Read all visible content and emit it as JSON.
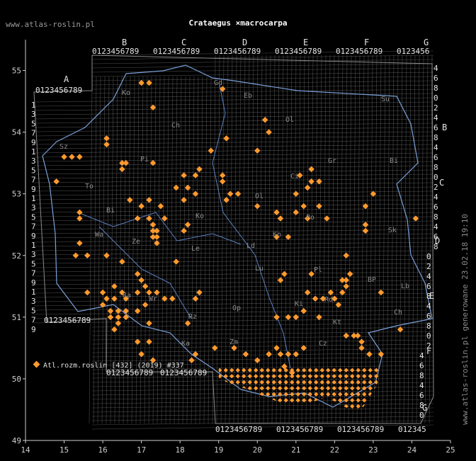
{
  "header": {
    "site": "www.atlas-roslin.pl",
    "title": "Crataegus ×macrocarpa"
  },
  "footer": {
    "text": "www.atlas-roslin.pl generowane 23.02.18 19:10"
  },
  "legend": {
    "label": "Atl.rozm.roslin [432] (2019) #337",
    "marker_color": "#ff9a2e"
  },
  "grid_labels": {
    "top_major": [
      "B",
      "C",
      "D",
      "E",
      "F",
      "G"
    ],
    "a_label": "A",
    "digits_row": "0123456789",
    "right_letters": [
      "B",
      "C",
      "D",
      "E",
      "F",
      "G"
    ],
    "right_digits": [
      "4",
      "6",
      "8",
      "0",
      "2",
      "4",
      "6",
      "8"
    ]
  },
  "region_labels": [
    "Sz",
    "Ko",
    "Gd",
    "Eb",
    "Ol",
    "Su",
    "Ch",
    "Pi",
    "Bi",
    "Ci",
    "Gr",
    "To",
    "Ol",
    "Po",
    "Ko",
    "Bi",
    "Ld",
    "Wa",
    "Ze",
    "Le",
    "Kn",
    "Sk",
    "BP",
    "Lu",
    "Pl",
    "Ra",
    "Wr",
    "Op",
    "Ki",
    "Rd",
    "Lb",
    "Ch",
    "Zm",
    "Kt",
    "Rz",
    "Ka",
    "Cz"
  ],
  "chart_data": {
    "type": "scatter",
    "xlim": [
      14,
      25
    ],
    "ylim": [
      49,
      55.5
    ],
    "x_ticks": [
      14,
      15,
      16,
      17,
      18,
      19,
      20,
      21,
      22,
      23,
      24,
      25
    ],
    "y_ticks": [
      49,
      50,
      51,
      52,
      53,
      54,
      55
    ],
    "marker_color": "#ff9a2e",
    "grid_color": "#6a6a6a",
    "points": [
      [
        17.0,
        54.8
      ],
      [
        17.2,
        54.8
      ],
      [
        19.1,
        54.7
      ],
      [
        17.3,
        54.4
      ],
      [
        20.2,
        54.2
      ],
      [
        20.3,
        54.0
      ],
      [
        19.2,
        53.9
      ],
      [
        16.1,
        53.9
      ],
      [
        16.1,
        53.8
      ],
      [
        15.0,
        53.6
      ],
      [
        15.2,
        53.6
      ],
      [
        15.4,
        53.6
      ],
      [
        18.8,
        53.7
      ],
      [
        20.0,
        53.7
      ],
      [
        16.5,
        53.5
      ],
      [
        16.6,
        53.5
      ],
      [
        17.3,
        53.5
      ],
      [
        16.5,
        53.4
      ],
      [
        18.5,
        53.4
      ],
      [
        14.8,
        53.2
      ],
      [
        21.4,
        53.4
      ],
      [
        21.1,
        53.3
      ],
      [
        21.4,
        53.2
      ],
      [
        21.6,
        53.2
      ],
      [
        18.1,
        53.3
      ],
      [
        18.4,
        53.3
      ],
      [
        19.1,
        53.3
      ],
      [
        19.1,
        53.2
      ],
      [
        21.3,
        53.1
      ],
      [
        17.9,
        53.1
      ],
      [
        18.2,
        53.1
      ],
      [
        18.4,
        53.0
      ],
      [
        19.3,
        53.0
      ],
      [
        19.5,
        53.0
      ],
      [
        21.0,
        53.0
      ],
      [
        23.0,
        53.0
      ],
      [
        16.7,
        52.9
      ],
      [
        17.0,
        52.8
      ],
      [
        17.2,
        52.9
      ],
      [
        17.5,
        52.8
      ],
      [
        18.1,
        52.9
      ],
      [
        19.2,
        52.9
      ],
      [
        20.0,
        52.8
      ],
      [
        21.2,
        52.8
      ],
      [
        21.6,
        52.8
      ],
      [
        15.4,
        52.7
      ],
      [
        15.4,
        52.6
      ],
      [
        20.5,
        52.7
      ],
      [
        20.6,
        52.6
      ],
      [
        21.0,
        52.7
      ],
      [
        21.3,
        52.6
      ],
      [
        21.8,
        52.6
      ],
      [
        22.8,
        52.8
      ],
      [
        16.9,
        52.6
      ],
      [
        17.2,
        52.6
      ],
      [
        17.6,
        52.6
      ],
      [
        17.3,
        52.5
      ],
      [
        17.4,
        52.4
      ],
      [
        18.2,
        52.5
      ],
      [
        18.1,
        52.4
      ],
      [
        17.4,
        52.3
      ],
      [
        17.4,
        52.2
      ],
      [
        17.3,
        52.4
      ],
      [
        17.3,
        52.3
      ],
      [
        22.8,
        52.5
      ],
      [
        22.8,
        52.4
      ],
      [
        24.1,
        52.6
      ],
      [
        20.5,
        52.3
      ],
      [
        20.8,
        52.3
      ],
      [
        15.4,
        52.2
      ],
      [
        15.3,
        52.0
      ],
      [
        16.1,
        52.0
      ],
      [
        15.6,
        52.0
      ],
      [
        16.5,
        51.9
      ],
      [
        17.9,
        51.9
      ],
      [
        22.3,
        52.0
      ],
      [
        16.9,
        51.7
      ],
      [
        17.0,
        51.6
      ],
      [
        17.1,
        51.5
      ],
      [
        20.7,
        51.7
      ],
      [
        21.4,
        51.7
      ],
      [
        20.6,
        51.6
      ],
      [
        22.3,
        51.6
      ],
      [
        22.4,
        51.7
      ],
      [
        22.2,
        51.6
      ],
      [
        22.3,
        51.5
      ],
      [
        22.2,
        51.4
      ],
      [
        23.2,
        51.4
      ],
      [
        15.6,
        51.4
      ],
      [
        16.0,
        51.4
      ],
      [
        16.3,
        51.5
      ],
      [
        16.5,
        51.4
      ],
      [
        16.1,
        51.3
      ],
      [
        16.3,
        51.3
      ],
      [
        16.6,
        51.3
      ],
      [
        16.9,
        51.4
      ],
      [
        17.2,
        51.4
      ],
      [
        17.4,
        51.4
      ],
      [
        17.6,
        51.3
      ],
      [
        17.8,
        51.3
      ],
      [
        18.4,
        51.3
      ],
      [
        18.5,
        51.4
      ],
      [
        21.3,
        51.4
      ],
      [
        21.5,
        51.3
      ],
      [
        21.7,
        51.3
      ],
      [
        21.9,
        51.4
      ],
      [
        22.0,
        51.3
      ],
      [
        22.1,
        51.2
      ],
      [
        16.0,
        51.2
      ],
      [
        16.2,
        51.1
      ],
      [
        16.4,
        51.1
      ],
      [
        16.6,
        51.1
      ],
      [
        16.9,
        51.1
      ],
      [
        17.1,
        51.2
      ],
      [
        20.5,
        51.0
      ],
      [
        20.8,
        51.0
      ],
      [
        21.0,
        51.0
      ],
      [
        21.2,
        51.1
      ],
      [
        21.6,
        51.0
      ],
      [
        16.2,
        51.0
      ],
      [
        16.4,
        51.0
      ],
      [
        16.6,
        51.0
      ],
      [
        16.4,
        50.9
      ],
      [
        16.3,
        50.8
      ],
      [
        17.2,
        50.9
      ],
      [
        18.2,
        50.9
      ],
      [
        22.3,
        50.7
      ],
      [
        22.5,
        50.7
      ],
      [
        22.6,
        50.7
      ],
      [
        22.7,
        50.6
      ],
      [
        23.7,
        50.8
      ],
      [
        16.9,
        50.6
      ],
      [
        17.2,
        50.6
      ],
      [
        17.0,
        50.4
      ],
      [
        17.3,
        50.3
      ],
      [
        18.3,
        50.3
      ],
      [
        18.4,
        50.4
      ],
      [
        18.9,
        50.5
      ],
      [
        19.4,
        50.5
      ],
      [
        19.7,
        50.4
      ],
      [
        20.0,
        50.3
      ],
      [
        20.3,
        50.4
      ],
      [
        20.5,
        50.5
      ],
      [
        20.6,
        50.4
      ],
      [
        20.8,
        50.4
      ],
      [
        21.0,
        50.4
      ],
      [
        21.2,
        50.5
      ],
      [
        20.7,
        50.2
      ],
      [
        20.9,
        50.1
      ],
      [
        22.7,
        50.5
      ],
      [
        22.9,
        50.4
      ],
      [
        23.2,
        50.4
      ]
    ],
    "region": [
      [
        19.0,
        50.2
      ],
      [
        23.2,
        50.2
      ],
      [
        23.1,
        49.9
      ],
      [
        22.9,
        49.7
      ],
      [
        22.7,
        49.5
      ],
      [
        22.4,
        49.5
      ],
      [
        22.1,
        49.6
      ],
      [
        21.8,
        49.7
      ],
      [
        21.3,
        49.6
      ],
      [
        20.7,
        49.6
      ],
      [
        20.2,
        49.7
      ],
      [
        19.9,
        49.8
      ],
      [
        19.4,
        49.9
      ],
      [
        19.0,
        50.0
      ]
    ]
  }
}
